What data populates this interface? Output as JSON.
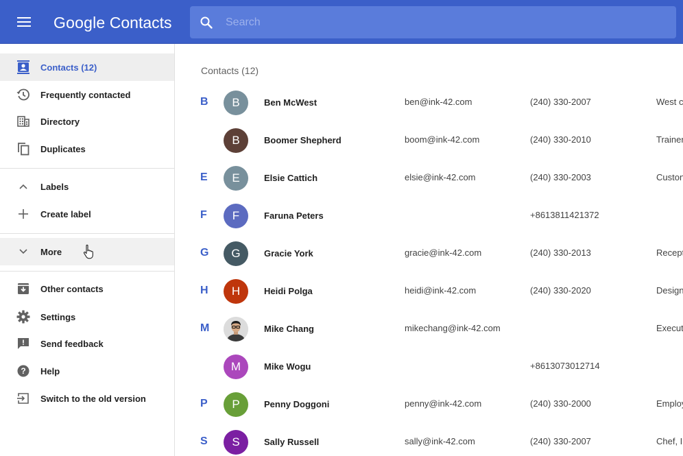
{
  "header": {
    "title_brand": "Google",
    "title_product": "Contacts",
    "search_placeholder": "Search",
    "color": "#3b5fc9"
  },
  "sidebar": {
    "contacts": "Contacts (12)",
    "frequently_contacted": "Frequently contacted",
    "directory": "Directory",
    "duplicates": "Duplicates",
    "labels": "Labels",
    "create_label": "Create label",
    "more": "More",
    "other_contacts": "Other contacts",
    "settings": "Settings",
    "send_feedback": "Send feedback",
    "help": "Help",
    "switch_old": "Switch to the old version"
  },
  "main": {
    "list_title": "Contacts (12)",
    "contacts": [
      {
        "letter": "B",
        "initial": "B",
        "avatar_color": "#78909c",
        "name": "Ben McWest",
        "email": "ben@ink-42.com",
        "phone": "(240) 330-2007",
        "job": "West c"
      },
      {
        "letter": "",
        "initial": "B",
        "avatar_color": "#5d4037",
        "name": "Boomer Shepherd",
        "email": "boom@ink-42.com",
        "phone": "(240) 330-2010",
        "job": "Trainer"
      },
      {
        "letter": "E",
        "initial": "E",
        "avatar_color": "#78909c",
        "name": "Elsie Cattich",
        "email": "elsie@ink-42.com",
        "phone": "(240) 330-2003",
        "job": "Custon"
      },
      {
        "letter": "F",
        "initial": "F",
        "avatar_color": "#5c6bc0",
        "name": "Faruna Peters",
        "email": "",
        "phone": "+8613811421372",
        "job": ""
      },
      {
        "letter": "G",
        "initial": "G",
        "avatar_color": "#455a64",
        "name": "Gracie York",
        "email": "gracie@ink-42.com",
        "phone": "(240) 330-2013",
        "job": "Recept"
      },
      {
        "letter": "H",
        "initial": "H",
        "avatar_color": "#bf360c",
        "name": "Heidi Polga",
        "email": "heidi@ink-42.com",
        "phone": "(240) 330-2020",
        "job": "Design"
      },
      {
        "letter": "M",
        "initial": "",
        "avatar_color": "#e0e0e0",
        "name": "Mike Chang",
        "email": "mikechang@ink-42.com",
        "phone": "",
        "job": "Execut"
      },
      {
        "letter": "",
        "initial": "M",
        "avatar_color": "#ab47bc",
        "name": "Mike Wogu",
        "email": "",
        "phone": "+8613073012714",
        "job": ""
      },
      {
        "letter": "P",
        "initial": "P",
        "avatar_color": "#689f38",
        "name": "Penny Doggoni",
        "email": "penny@ink-42.com",
        "phone": "(240) 330-2000",
        "job": "Employ"
      },
      {
        "letter": "S",
        "initial": "S",
        "avatar_color": "#7b1fa2",
        "name": "Sally Russell",
        "email": "sally@ink-42.com",
        "phone": "(240) 330-2007",
        "job": "Chef, Ir"
      }
    ]
  }
}
